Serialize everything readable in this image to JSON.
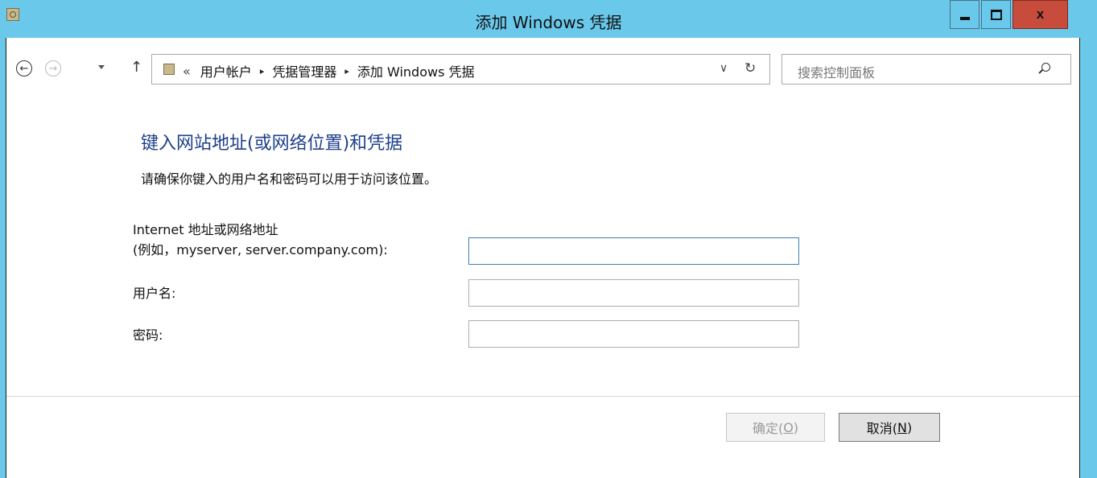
{
  "window": {
    "title": "添加 Windows 凭据",
    "close_glyph": "x"
  },
  "nav": {
    "back_glyph": "←",
    "forward_glyph": "→",
    "up_glyph": "↑",
    "breadcrumb_lead": "«",
    "breadcrumbs": [
      "用户帐户",
      "凭据管理器",
      "添加 Windows 凭据"
    ],
    "crumb_separator": "▸",
    "dropdown_glyph": "∨",
    "refresh_glyph": "↻"
  },
  "search": {
    "placeholder": "搜索控制面板"
  },
  "form": {
    "heading": "键入网站地址(或网络位置)和凭据",
    "instruction": "请确保你键入的用户名和密码可以用于访问该位置。",
    "address_label_line1": "Internet 地址或网络地址",
    "address_label_line2": "(例如，myserver, server.company.com):",
    "address_value": "",
    "username_label": "用户名:",
    "username_value": "",
    "password_label": "密码:",
    "password_value": ""
  },
  "buttons": {
    "ok_label": "确定(",
    "ok_key": "O",
    "ok_suffix": ")",
    "ok_enabled": false,
    "cancel_label": "取消(",
    "cancel_key": "N",
    "cancel_suffix": ")"
  },
  "colors": {
    "titlebar": "#6ac8ea",
    "close_button": "#c74c3c",
    "heading": "#1e3f8a",
    "focus_border": "#3c7fb1"
  }
}
